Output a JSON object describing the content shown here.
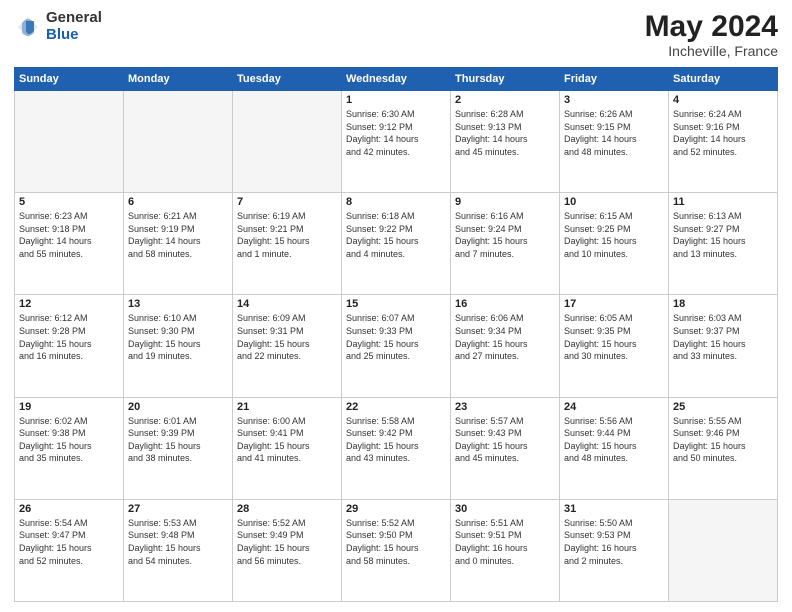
{
  "header": {
    "logo_general": "General",
    "logo_blue": "Blue",
    "title": "May 2024",
    "location": "Incheville, France"
  },
  "days_of_week": [
    "Sunday",
    "Monday",
    "Tuesday",
    "Wednesday",
    "Thursday",
    "Friday",
    "Saturday"
  ],
  "weeks": [
    [
      {
        "day": "",
        "empty": true,
        "lines": []
      },
      {
        "day": "",
        "empty": true,
        "lines": []
      },
      {
        "day": "",
        "empty": true,
        "lines": []
      },
      {
        "day": "1",
        "empty": false,
        "lines": [
          "Sunrise: 6:30 AM",
          "Sunset: 9:12 PM",
          "Daylight: 14 hours",
          "and 42 minutes."
        ]
      },
      {
        "day": "2",
        "empty": false,
        "lines": [
          "Sunrise: 6:28 AM",
          "Sunset: 9:13 PM",
          "Daylight: 14 hours",
          "and 45 minutes."
        ]
      },
      {
        "day": "3",
        "empty": false,
        "lines": [
          "Sunrise: 6:26 AM",
          "Sunset: 9:15 PM",
          "Daylight: 14 hours",
          "and 48 minutes."
        ]
      },
      {
        "day": "4",
        "empty": false,
        "lines": [
          "Sunrise: 6:24 AM",
          "Sunset: 9:16 PM",
          "Daylight: 14 hours",
          "and 52 minutes."
        ]
      }
    ],
    [
      {
        "day": "5",
        "empty": false,
        "lines": [
          "Sunrise: 6:23 AM",
          "Sunset: 9:18 PM",
          "Daylight: 14 hours",
          "and 55 minutes."
        ]
      },
      {
        "day": "6",
        "empty": false,
        "lines": [
          "Sunrise: 6:21 AM",
          "Sunset: 9:19 PM",
          "Daylight: 14 hours",
          "and 58 minutes."
        ]
      },
      {
        "day": "7",
        "empty": false,
        "lines": [
          "Sunrise: 6:19 AM",
          "Sunset: 9:21 PM",
          "Daylight: 15 hours",
          "and 1 minute."
        ]
      },
      {
        "day": "8",
        "empty": false,
        "lines": [
          "Sunrise: 6:18 AM",
          "Sunset: 9:22 PM",
          "Daylight: 15 hours",
          "and 4 minutes."
        ]
      },
      {
        "day": "9",
        "empty": false,
        "lines": [
          "Sunrise: 6:16 AM",
          "Sunset: 9:24 PM",
          "Daylight: 15 hours",
          "and 7 minutes."
        ]
      },
      {
        "day": "10",
        "empty": false,
        "lines": [
          "Sunrise: 6:15 AM",
          "Sunset: 9:25 PM",
          "Daylight: 15 hours",
          "and 10 minutes."
        ]
      },
      {
        "day": "11",
        "empty": false,
        "lines": [
          "Sunrise: 6:13 AM",
          "Sunset: 9:27 PM",
          "Daylight: 15 hours",
          "and 13 minutes."
        ]
      }
    ],
    [
      {
        "day": "12",
        "empty": false,
        "lines": [
          "Sunrise: 6:12 AM",
          "Sunset: 9:28 PM",
          "Daylight: 15 hours",
          "and 16 minutes."
        ]
      },
      {
        "day": "13",
        "empty": false,
        "lines": [
          "Sunrise: 6:10 AM",
          "Sunset: 9:30 PM",
          "Daylight: 15 hours",
          "and 19 minutes."
        ]
      },
      {
        "day": "14",
        "empty": false,
        "lines": [
          "Sunrise: 6:09 AM",
          "Sunset: 9:31 PM",
          "Daylight: 15 hours",
          "and 22 minutes."
        ]
      },
      {
        "day": "15",
        "empty": false,
        "lines": [
          "Sunrise: 6:07 AM",
          "Sunset: 9:33 PM",
          "Daylight: 15 hours",
          "and 25 minutes."
        ]
      },
      {
        "day": "16",
        "empty": false,
        "lines": [
          "Sunrise: 6:06 AM",
          "Sunset: 9:34 PM",
          "Daylight: 15 hours",
          "and 27 minutes."
        ]
      },
      {
        "day": "17",
        "empty": false,
        "lines": [
          "Sunrise: 6:05 AM",
          "Sunset: 9:35 PM",
          "Daylight: 15 hours",
          "and 30 minutes."
        ]
      },
      {
        "day": "18",
        "empty": false,
        "lines": [
          "Sunrise: 6:03 AM",
          "Sunset: 9:37 PM",
          "Daylight: 15 hours",
          "and 33 minutes."
        ]
      }
    ],
    [
      {
        "day": "19",
        "empty": false,
        "lines": [
          "Sunrise: 6:02 AM",
          "Sunset: 9:38 PM",
          "Daylight: 15 hours",
          "and 35 minutes."
        ]
      },
      {
        "day": "20",
        "empty": false,
        "lines": [
          "Sunrise: 6:01 AM",
          "Sunset: 9:39 PM",
          "Daylight: 15 hours",
          "and 38 minutes."
        ]
      },
      {
        "day": "21",
        "empty": false,
        "lines": [
          "Sunrise: 6:00 AM",
          "Sunset: 9:41 PM",
          "Daylight: 15 hours",
          "and 41 minutes."
        ]
      },
      {
        "day": "22",
        "empty": false,
        "lines": [
          "Sunrise: 5:58 AM",
          "Sunset: 9:42 PM",
          "Daylight: 15 hours",
          "and 43 minutes."
        ]
      },
      {
        "day": "23",
        "empty": false,
        "lines": [
          "Sunrise: 5:57 AM",
          "Sunset: 9:43 PM",
          "Daylight: 15 hours",
          "and 45 minutes."
        ]
      },
      {
        "day": "24",
        "empty": false,
        "lines": [
          "Sunrise: 5:56 AM",
          "Sunset: 9:44 PM",
          "Daylight: 15 hours",
          "and 48 minutes."
        ]
      },
      {
        "day": "25",
        "empty": false,
        "lines": [
          "Sunrise: 5:55 AM",
          "Sunset: 9:46 PM",
          "Daylight: 15 hours",
          "and 50 minutes."
        ]
      }
    ],
    [
      {
        "day": "26",
        "empty": false,
        "lines": [
          "Sunrise: 5:54 AM",
          "Sunset: 9:47 PM",
          "Daylight: 15 hours",
          "and 52 minutes."
        ]
      },
      {
        "day": "27",
        "empty": false,
        "lines": [
          "Sunrise: 5:53 AM",
          "Sunset: 9:48 PM",
          "Daylight: 15 hours",
          "and 54 minutes."
        ]
      },
      {
        "day": "28",
        "empty": false,
        "lines": [
          "Sunrise: 5:52 AM",
          "Sunset: 9:49 PM",
          "Daylight: 15 hours",
          "and 56 minutes."
        ]
      },
      {
        "day": "29",
        "empty": false,
        "lines": [
          "Sunrise: 5:52 AM",
          "Sunset: 9:50 PM",
          "Daylight: 15 hours",
          "and 58 minutes."
        ]
      },
      {
        "day": "30",
        "empty": false,
        "lines": [
          "Sunrise: 5:51 AM",
          "Sunset: 9:51 PM",
          "Daylight: 16 hours",
          "and 0 minutes."
        ]
      },
      {
        "day": "31",
        "empty": false,
        "lines": [
          "Sunrise: 5:50 AM",
          "Sunset: 9:53 PM",
          "Daylight: 16 hours",
          "and 2 minutes."
        ]
      },
      {
        "day": "",
        "empty": true,
        "lines": []
      }
    ]
  ]
}
